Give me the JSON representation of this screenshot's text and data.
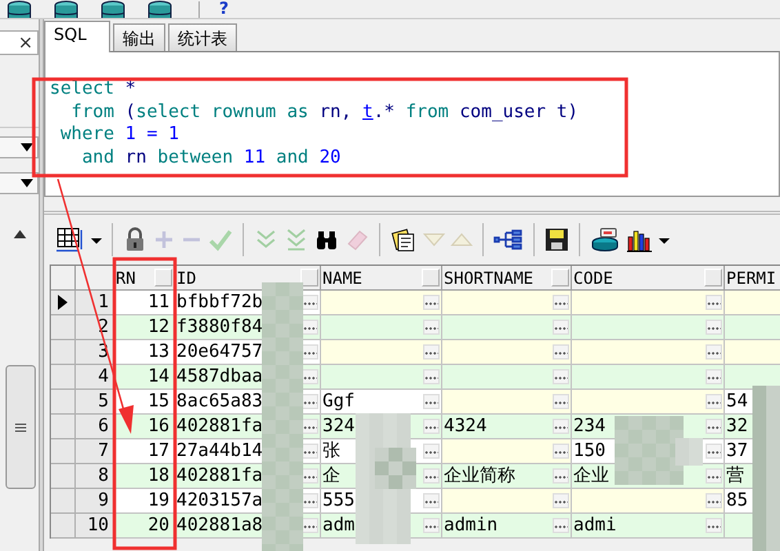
{
  "top_toolbar": {
    "icons": [
      {
        "kind": "database"
      },
      {
        "kind": "database"
      },
      {
        "kind": "database"
      },
      {
        "kind": "database"
      }
    ],
    "help": "?"
  },
  "left_panel": {
    "close": "×",
    "dropdowns": [
      {
        "expanded": false
      },
      {
        "expanded": false
      }
    ]
  },
  "tabs": [
    {
      "label": "SQL",
      "selected": true
    },
    {
      "label": "输出",
      "selected": false
    },
    {
      "label": "统计表",
      "selected": false
    }
  ],
  "sql": [
    [
      {
        "text": "select",
        "kind": "keyword"
      },
      {
        "text": " *",
        "kind": "ident"
      }
    ],
    [
      {
        "text": "  from",
        "kind": "keyword"
      },
      {
        "text": " (",
        "kind": "ident"
      },
      {
        "text": "select",
        "kind": "keyword"
      },
      {
        "text": " rownum",
        "kind": "keyword"
      },
      {
        "text": " as",
        "kind": "keyword"
      },
      {
        "text": " rn, ",
        "kind": "ident"
      },
      {
        "text": "t",
        "kind": "link"
      },
      {
        "text": ".* ",
        "kind": "ident"
      },
      {
        "text": "from",
        "kind": "keyword"
      },
      {
        "text": " com_user t)",
        "kind": "ident"
      }
    ],
    [
      {
        "text": " where",
        "kind": "keyword"
      },
      {
        "text": " 1 = 1",
        "kind": "number"
      }
    ],
    [
      {
        "text": "   and",
        "kind": "keyword"
      },
      {
        "text": " rn ",
        "kind": "ident"
      },
      {
        "text": "between",
        "kind": "keyword"
      },
      {
        "text": " 11 ",
        "kind": "number"
      },
      {
        "text": "and",
        "kind": "keyword"
      },
      {
        "text": " 20",
        "kind": "number"
      }
    ]
  ],
  "grid_toolbar": [
    {
      "kind": "grid",
      "disabled": false
    },
    {
      "kind": "caret",
      "disabled": false
    },
    {
      "kind": "lock",
      "disabled": false,
      "separator_before": true
    },
    {
      "kind": "plus",
      "disabled": true
    },
    {
      "kind": "minus",
      "disabled": true
    },
    {
      "kind": "check",
      "disabled": true
    },
    {
      "kind": "fetch-next",
      "disabled": true,
      "separator_before": true
    },
    {
      "kind": "fetch-last",
      "disabled": true
    },
    {
      "kind": "binoculars",
      "disabled": false
    },
    {
      "kind": "eraser",
      "disabled": true
    },
    {
      "kind": "notes",
      "disabled": false,
      "separator_before": true
    },
    {
      "kind": "down",
      "disabled": true
    },
    {
      "kind": "up",
      "disabled": true
    },
    {
      "kind": "tree",
      "disabled": false,
      "separator_before": true
    },
    {
      "kind": "save",
      "disabled": false,
      "separator_before": true
    },
    {
      "kind": "database",
      "disabled": false,
      "separator_before": true
    },
    {
      "kind": "chart",
      "disabled": false
    },
    {
      "kind": "caret",
      "disabled": false
    }
  ],
  "grid": {
    "columns": [
      {
        "label": "RN",
        "sort_button": true,
        "editor_button": false
      },
      {
        "label": "ID",
        "sort_button": true,
        "editor_button": true
      },
      {
        "label": "NAME",
        "sort_button": true,
        "editor_button": true
      },
      {
        "label": "SHORTNAME",
        "sort_button": true,
        "editor_button": true
      },
      {
        "label": "CODE",
        "sort_button": true,
        "editor_button": true
      },
      {
        "label": "PERMI",
        "sort_button": false,
        "editor_button": false
      }
    ],
    "rows": [
      {
        "number": "1",
        "current": true,
        "cells": [
          "11",
          "bfbbf72b",
          null,
          null,
          null,
          null
        ]
      },
      {
        "number": "2",
        "current": false,
        "cells": [
          "12",
          "f3880f84",
          null,
          null,
          null,
          null
        ]
      },
      {
        "number": "3",
        "current": false,
        "cells": [
          "13",
          "20e64757",
          null,
          null,
          null,
          null
        ]
      },
      {
        "number": "4",
        "current": false,
        "cells": [
          "14",
          "4587dbaa",
          null,
          null,
          null,
          null
        ]
      },
      {
        "number": "5",
        "current": false,
        "cells": [
          "15",
          "8ac65a83",
          "Ggf",
          null,
          null,
          "54"
        ]
      },
      {
        "number": "6",
        "current": false,
        "cells": [
          "16",
          "402881fa",
          "324",
          "4324",
          "234",
          "32"
        ]
      },
      {
        "number": "7",
        "current": false,
        "cells": [
          "17",
          "27a44b14",
          "张",
          null,
          "150",
          "37"
        ]
      },
      {
        "number": "8",
        "current": false,
        "cells": [
          "18",
          "402881fa",
          "企",
          "企业简称",
          "企业",
          "营"
        ]
      },
      {
        "number": "9",
        "current": false,
        "cells": [
          "19",
          "4203157a",
          "555",
          null,
          null,
          "85"
        ]
      },
      {
        "number": "10",
        "current": false,
        "cells": [
          "20",
          "402881a8",
          "adm",
          "admin",
          "admi",
          null
        ]
      }
    ]
  }
}
